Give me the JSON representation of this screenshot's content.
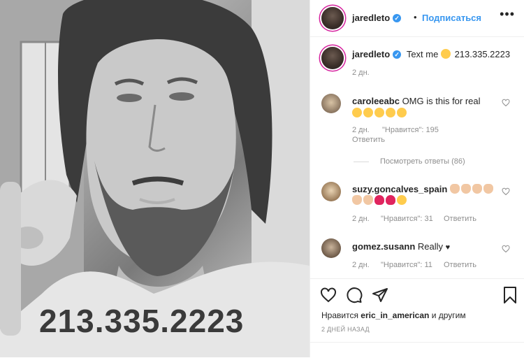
{
  "post": {
    "image_text": "213.335.2223"
  },
  "header": {
    "username": "jaredleto",
    "separator": "•",
    "follow_label": "Подписаться",
    "more_label": "•••"
  },
  "caption": {
    "username": "jaredleto",
    "text": "Text me",
    "number": "213.335.2223",
    "time": "2 дн."
  },
  "comments": [
    {
      "username": "caroleeabc",
      "text": "OMG is this for real",
      "time": "2 дн.",
      "likes": "\"Нравится\": 195",
      "reply": "Ответить"
    },
    {
      "username": "suzy.goncalves_spain",
      "text": "",
      "time": "2 дн.",
      "likes": "\"Нравится\": 31",
      "reply": "Ответить"
    },
    {
      "username": "gomez.susann",
      "text": "Really",
      "time": "2 дн.",
      "likes": "\"Нравится\": 11",
      "reply": "Ответить"
    }
  ],
  "view_replies": "Посмотреть ответы (86)",
  "footer": {
    "likes_prefix": "Нравится",
    "likes_user": "eric_in_american",
    "likes_suffix": "и другим",
    "time_ago": "2 ДНЕЙ НАЗАД"
  },
  "icons": {
    "like": "heart-icon",
    "comment": "comment-icon",
    "share": "share-icon",
    "save": "bookmark-icon"
  },
  "colors": {
    "link": "#3897f0",
    "verified": "#3897f0",
    "meta": "#8e8e8e"
  }
}
